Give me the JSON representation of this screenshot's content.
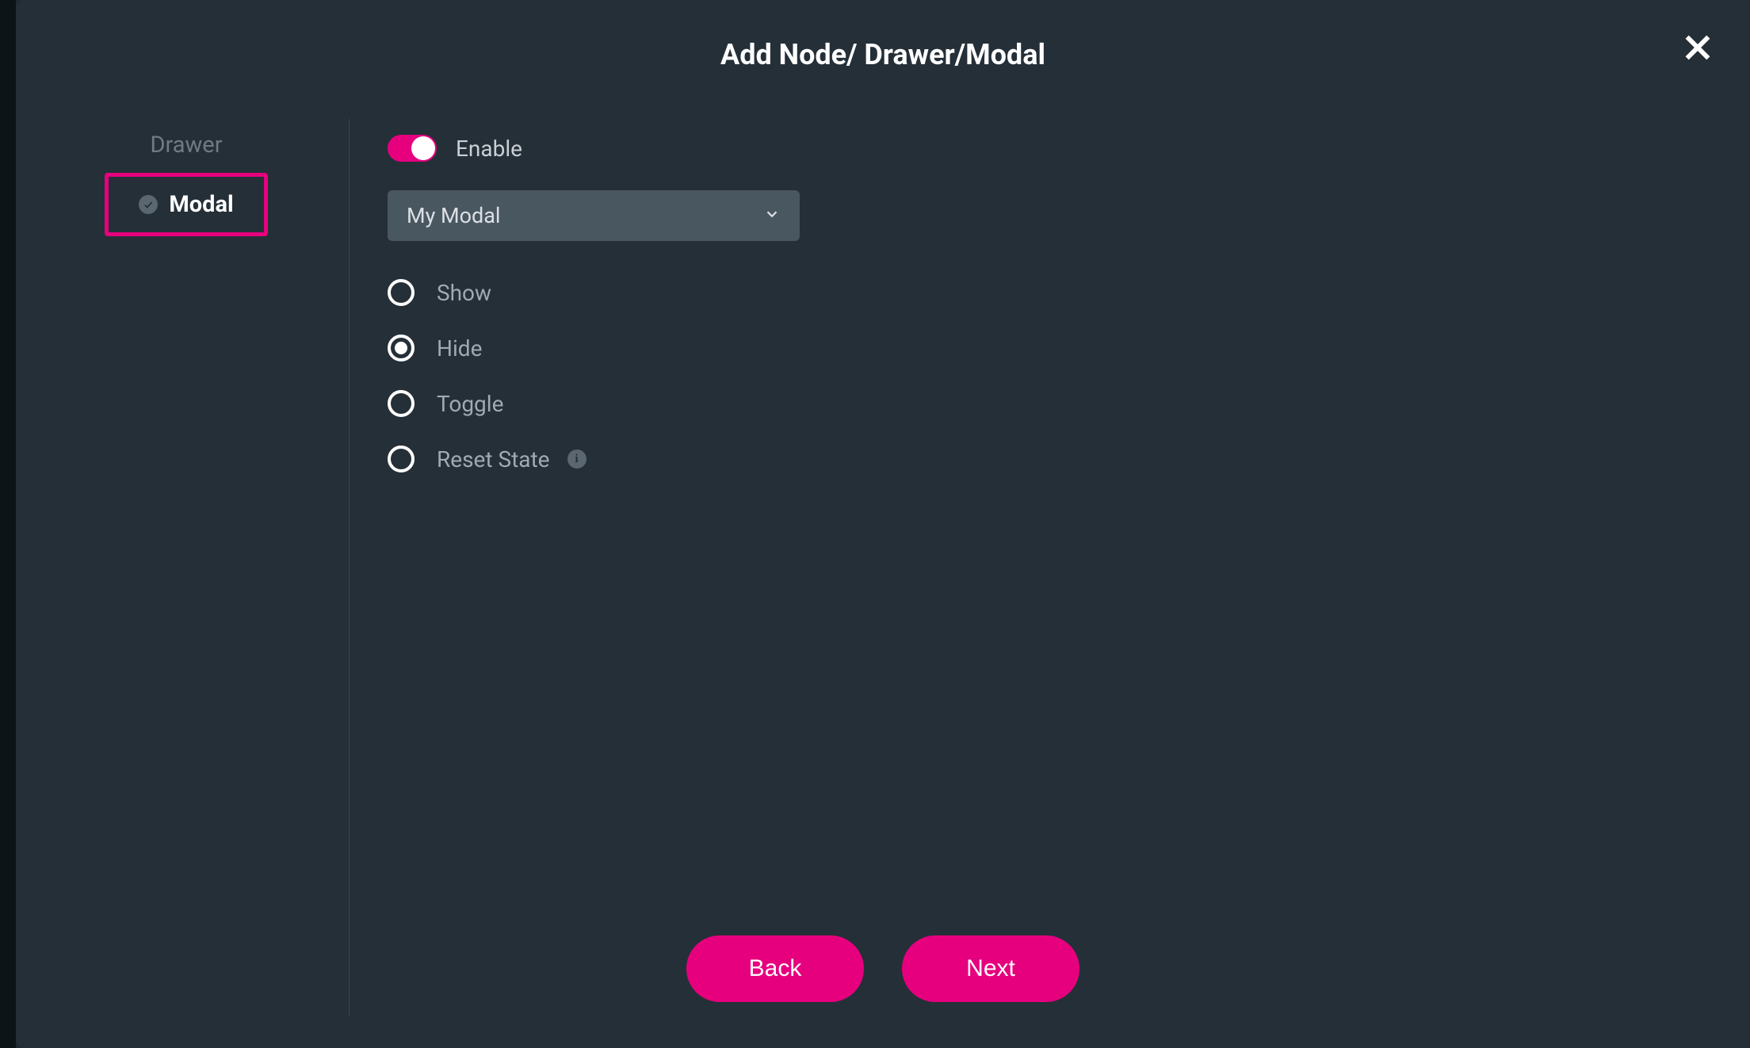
{
  "header": {
    "title": "Add Node/ Drawer/Modal"
  },
  "sidebar": {
    "items": [
      {
        "label": "Drawer",
        "active": false
      },
      {
        "label": "Modal",
        "active": true
      }
    ]
  },
  "main": {
    "enable_label": "Enable",
    "enable_value": true,
    "select_value": "My Modal",
    "radio_options": [
      {
        "label": "Show",
        "selected": false
      },
      {
        "label": "Hide",
        "selected": true
      },
      {
        "label": "Toggle",
        "selected": false
      },
      {
        "label": "Reset State",
        "selected": false,
        "info": true
      }
    ]
  },
  "footer": {
    "back_label": "Back",
    "next_label": "Next"
  },
  "colors": {
    "accent": "#e6007e",
    "panel": "#252f38",
    "field": "#495761"
  }
}
